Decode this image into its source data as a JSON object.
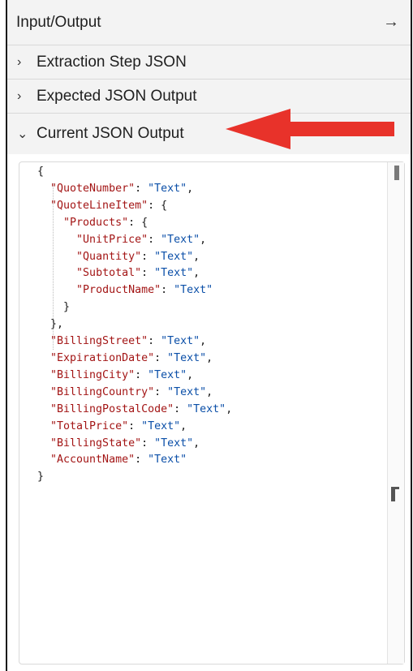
{
  "header": {
    "title": "Input/Output",
    "collapse_icon": "arrow-right-icon"
  },
  "sections": [
    {
      "label": "Extraction Step JSON",
      "state": "collapsed",
      "icon": "chevron-right-icon"
    },
    {
      "label": "Expected JSON Output",
      "state": "collapsed",
      "icon": "chevron-right-icon"
    },
    {
      "label": "Current JSON Output",
      "state": "expanded",
      "icon": "chevron-down-icon"
    }
  ],
  "icons": {
    "chevron_right": "›",
    "chevron_down": "⌄",
    "arrow_right": "→"
  },
  "colors": {
    "json_key": "#a31515",
    "json_string": "#0b4fa8",
    "annotation_arrow": "#e8322a",
    "section_background": "#f3f3f3"
  },
  "editor": {
    "lines": [
      {
        "indent": 0,
        "key": null,
        "value": null,
        "punct": "{"
      },
      {
        "indent": 1,
        "key": "\"QuoteNumber\"",
        "value": "\"Text\"",
        "punct": ","
      },
      {
        "indent": 1,
        "key": "\"QuoteLineItem\"",
        "value": null,
        "punct": "{"
      },
      {
        "indent": 2,
        "key": "\"Products\"",
        "value": null,
        "punct": "{"
      },
      {
        "indent": 3,
        "key": "\"UnitPrice\"",
        "value": "\"Text\"",
        "punct": ","
      },
      {
        "indent": 3,
        "key": "\"Quantity\"",
        "value": "\"Text\"",
        "punct": ","
      },
      {
        "indent": 3,
        "key": "\"Subtotal\"",
        "value": "\"Text\"",
        "punct": ","
      },
      {
        "indent": 3,
        "key": "\"ProductName\"",
        "value": "\"Text\"",
        "punct": ""
      },
      {
        "indent": 2,
        "key": null,
        "value": null,
        "punct": "}"
      },
      {
        "indent": 1,
        "key": null,
        "value": null,
        "punct": "},"
      },
      {
        "indent": 1,
        "key": "\"BillingStreet\"",
        "value": "\"Text\"",
        "punct": ","
      },
      {
        "indent": 1,
        "key": "\"ExpirationDate\"",
        "value": "\"Text\"",
        "punct": ","
      },
      {
        "indent": 1,
        "key": "\"BillingCity\"",
        "value": "\"Text\"",
        "punct": ","
      },
      {
        "indent": 1,
        "key": "\"BillingCountry\"",
        "value": "\"Text\"",
        "punct": ","
      },
      {
        "indent": 1,
        "key": "\"BillingPostalCode\"",
        "value": "\"Text\"",
        "punct": ","
      },
      {
        "indent": 1,
        "key": "\"TotalPrice\"",
        "value": "\"Text\"",
        "punct": ","
      },
      {
        "indent": 1,
        "key": "\"BillingState\"",
        "value": "\"Text\"",
        "punct": ","
      },
      {
        "indent": 1,
        "key": "\"AccountName\"",
        "value": "\"Text\"",
        "punct": ""
      },
      {
        "indent": 0,
        "key": null,
        "value": null,
        "punct": "}"
      }
    ]
  }
}
